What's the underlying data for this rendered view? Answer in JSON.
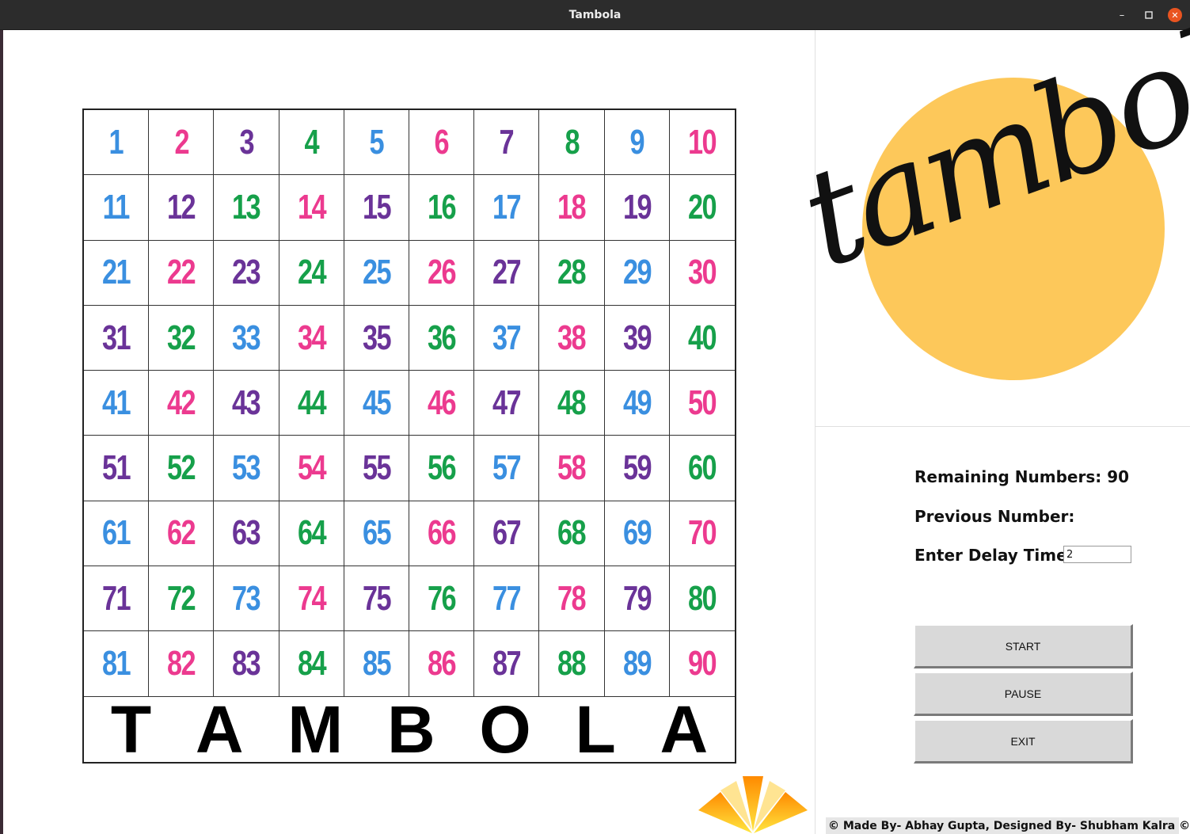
{
  "window": {
    "title": "Tambola"
  },
  "board": {
    "numbers": [
      {
        "n": "1",
        "c": "blue"
      },
      {
        "n": "2",
        "c": "pink"
      },
      {
        "n": "3",
        "c": "purple"
      },
      {
        "n": "4",
        "c": "green"
      },
      {
        "n": "5",
        "c": "blue"
      },
      {
        "n": "6",
        "c": "pink"
      },
      {
        "n": "7",
        "c": "purple"
      },
      {
        "n": "8",
        "c": "green"
      },
      {
        "n": "9",
        "c": "blue"
      },
      {
        "n": "10",
        "c": "pink"
      },
      {
        "n": "11",
        "c": "blue"
      },
      {
        "n": "12",
        "c": "purple"
      },
      {
        "n": "13",
        "c": "green"
      },
      {
        "n": "14",
        "c": "pink"
      },
      {
        "n": "15",
        "c": "purple"
      },
      {
        "n": "16",
        "c": "green"
      },
      {
        "n": "17",
        "c": "blue"
      },
      {
        "n": "18",
        "c": "pink"
      },
      {
        "n": "19",
        "c": "purple"
      },
      {
        "n": "20",
        "c": "green"
      },
      {
        "n": "21",
        "c": "blue"
      },
      {
        "n": "22",
        "c": "pink"
      },
      {
        "n": "23",
        "c": "purple"
      },
      {
        "n": "24",
        "c": "green"
      },
      {
        "n": "25",
        "c": "blue"
      },
      {
        "n": "26",
        "c": "pink"
      },
      {
        "n": "27",
        "c": "purple"
      },
      {
        "n": "28",
        "c": "green"
      },
      {
        "n": "29",
        "c": "blue"
      },
      {
        "n": "30",
        "c": "pink"
      },
      {
        "n": "31",
        "c": "purple"
      },
      {
        "n": "32",
        "c": "green"
      },
      {
        "n": "33",
        "c": "blue"
      },
      {
        "n": "34",
        "c": "pink"
      },
      {
        "n": "35",
        "c": "purple"
      },
      {
        "n": "36",
        "c": "green"
      },
      {
        "n": "37",
        "c": "blue"
      },
      {
        "n": "38",
        "c": "pink"
      },
      {
        "n": "39",
        "c": "purple"
      },
      {
        "n": "40",
        "c": "green"
      },
      {
        "n": "41",
        "c": "blue"
      },
      {
        "n": "42",
        "c": "pink"
      },
      {
        "n": "43",
        "c": "purple"
      },
      {
        "n": "44",
        "c": "green"
      },
      {
        "n": "45",
        "c": "blue"
      },
      {
        "n": "46",
        "c": "pink"
      },
      {
        "n": "47",
        "c": "purple"
      },
      {
        "n": "48",
        "c": "green"
      },
      {
        "n": "49",
        "c": "blue"
      },
      {
        "n": "50",
        "c": "pink"
      },
      {
        "n": "51",
        "c": "purple"
      },
      {
        "n": "52",
        "c": "green"
      },
      {
        "n": "53",
        "c": "blue"
      },
      {
        "n": "54",
        "c": "pink"
      },
      {
        "n": "55",
        "c": "purple"
      },
      {
        "n": "56",
        "c": "green"
      },
      {
        "n": "57",
        "c": "blue"
      },
      {
        "n": "58",
        "c": "pink"
      },
      {
        "n": "59",
        "c": "purple"
      },
      {
        "n": "60",
        "c": "green"
      },
      {
        "n": "61",
        "c": "blue"
      },
      {
        "n": "62",
        "c": "pink"
      },
      {
        "n": "63",
        "c": "purple"
      },
      {
        "n": "64",
        "c": "green"
      },
      {
        "n": "65",
        "c": "blue"
      },
      {
        "n": "66",
        "c": "pink"
      },
      {
        "n": "67",
        "c": "purple"
      },
      {
        "n": "68",
        "c": "green"
      },
      {
        "n": "69",
        "c": "blue"
      },
      {
        "n": "70",
        "c": "pink"
      },
      {
        "n": "71",
        "c": "purple"
      },
      {
        "n": "72",
        "c": "green"
      },
      {
        "n": "73",
        "c": "blue"
      },
      {
        "n": "74",
        "c": "pink"
      },
      {
        "n": "75",
        "c": "purple"
      },
      {
        "n": "76",
        "c": "green"
      },
      {
        "n": "77",
        "c": "blue"
      },
      {
        "n": "78",
        "c": "pink"
      },
      {
        "n": "79",
        "c": "purple"
      },
      {
        "n": "80",
        "c": "green"
      },
      {
        "n": "81",
        "c": "blue"
      },
      {
        "n": "82",
        "c": "pink"
      },
      {
        "n": "83",
        "c": "purple"
      },
      {
        "n": "84",
        "c": "green"
      },
      {
        "n": "85",
        "c": "blue"
      },
      {
        "n": "86",
        "c": "pink"
      },
      {
        "n": "87",
        "c": "purple"
      },
      {
        "n": "88",
        "c": "green"
      },
      {
        "n": "89",
        "c": "blue"
      },
      {
        "n": "90",
        "c": "pink"
      }
    ],
    "banner_letters": [
      "T",
      "A",
      "M",
      "B",
      "O",
      "L",
      "A"
    ]
  },
  "colors": {
    "blue": "#3a8fe0",
    "pink": "#ec3a8f",
    "purple": "#6a3398",
    "green": "#16a04a",
    "logo_circle": "#fdc85a",
    "close_button": "#e95420"
  },
  "logo": {
    "text": "tambola"
  },
  "panel": {
    "remaining_label": "Remaining Numbers: 90",
    "previous_label": "Previous Number:",
    "delay_label": "Enter Delay Time:",
    "delay_value": "2"
  },
  "buttons": {
    "start": "START",
    "pause": "PAUSE",
    "exit": "EXIT"
  },
  "footer": {
    "credit": "© Made By- Abhay Gupta, Designed By- Shubham Kalra ©"
  },
  "icons": {
    "minimize": "minimize-icon",
    "maximize": "maximize-icon",
    "close": "close-icon",
    "burst": "burst-icon"
  }
}
